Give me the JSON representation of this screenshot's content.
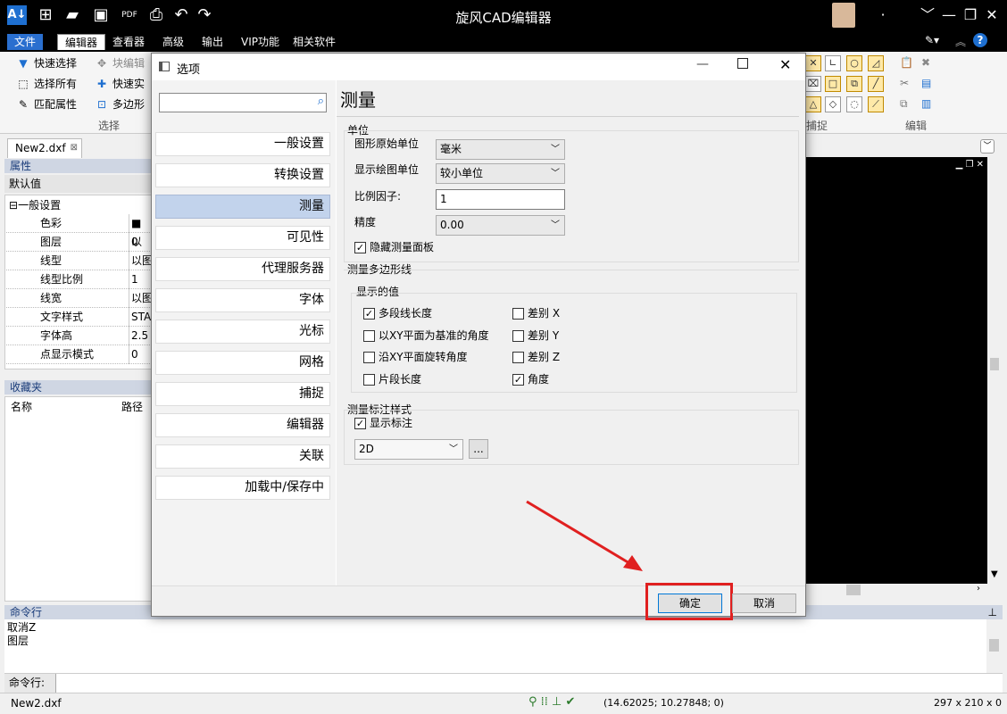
{
  "app": {
    "title": "旋风CAD编辑器"
  },
  "menus": [
    "文件",
    "编辑器",
    "查看器",
    "高级",
    "输出",
    "VIP功能",
    "相关软件"
  ],
  "ribbon": {
    "quick_select": "快速选择",
    "select_all": "选择所有",
    "match_props": "匹配属性",
    "block_edit": "块编辑",
    "quick_solid": "快速实",
    "polyline": "多边形",
    "group_select": "选择",
    "group_snap": "捕捉",
    "group_edit": "编辑"
  },
  "doc_tab": "New2.dxf",
  "properties": {
    "header": "属性",
    "default_label": "默认值",
    "group": "一般设置",
    "rows": [
      {
        "k": "色彩",
        "v": "■ 以"
      },
      {
        "k": "图层",
        "v": "0"
      },
      {
        "k": "线型",
        "v": "以图"
      },
      {
        "k": "线型比例",
        "v": "1"
      },
      {
        "k": "线宽",
        "v": "以图"
      },
      {
        "k": "文字样式",
        "v": "STAN"
      },
      {
        "k": "字体高",
        "v": "2.5"
      },
      {
        "k": "点显示模式",
        "v": "0"
      }
    ]
  },
  "favorites": {
    "header": "收藏夹",
    "col_name": "名称",
    "col_path": "路径"
  },
  "dialog": {
    "title": "选项",
    "nav": [
      "一般设置",
      "转换设置",
      "测量",
      "可见性",
      "代理服务器",
      "字体",
      "光标",
      "网格",
      "捕捉",
      "编辑器",
      "关联",
      "加载中/保存中"
    ],
    "page_title": "测量",
    "units_section": "单位",
    "drawing_unit_label": "图形原始单位",
    "drawing_unit_value": "毫米",
    "display_unit_label": "显示绘图单位",
    "display_unit_value": "较小单位",
    "scale_label": "比例因子:",
    "scale_value": "1",
    "precision_label": "精度",
    "precision_value": "0.00",
    "hide_panel": "隐藏测量面板",
    "poly_section": "测量多边形线",
    "display_values": "显示的值",
    "cb_poly_length": "多段线长度",
    "cb_xy_angle": "以XY平面为基准的角度",
    "cb_xy_rotate": "沿XY平面旋转角度",
    "cb_segment": "片段长度",
    "cb_dx": "差别 X",
    "cb_dy": "差别 Y",
    "cb_dz": "差别 Z",
    "cb_angle": "角度",
    "dim_section": "测量标注样式",
    "show_dim": "显示标注",
    "dim_mode": "2D",
    "more": "...",
    "ok": "确定",
    "cancel": "取消",
    "check": "✓"
  },
  "command": {
    "header": "命令行",
    "lines": [
      "取消Z",
      "图层"
    ],
    "prompt": "命令行:"
  },
  "status": {
    "file": "New2.dxf",
    "coords": "(14.62025; 10.27848; 0)",
    "paper": "297 x 210 x 0"
  },
  "highlight_color": "#e02020"
}
